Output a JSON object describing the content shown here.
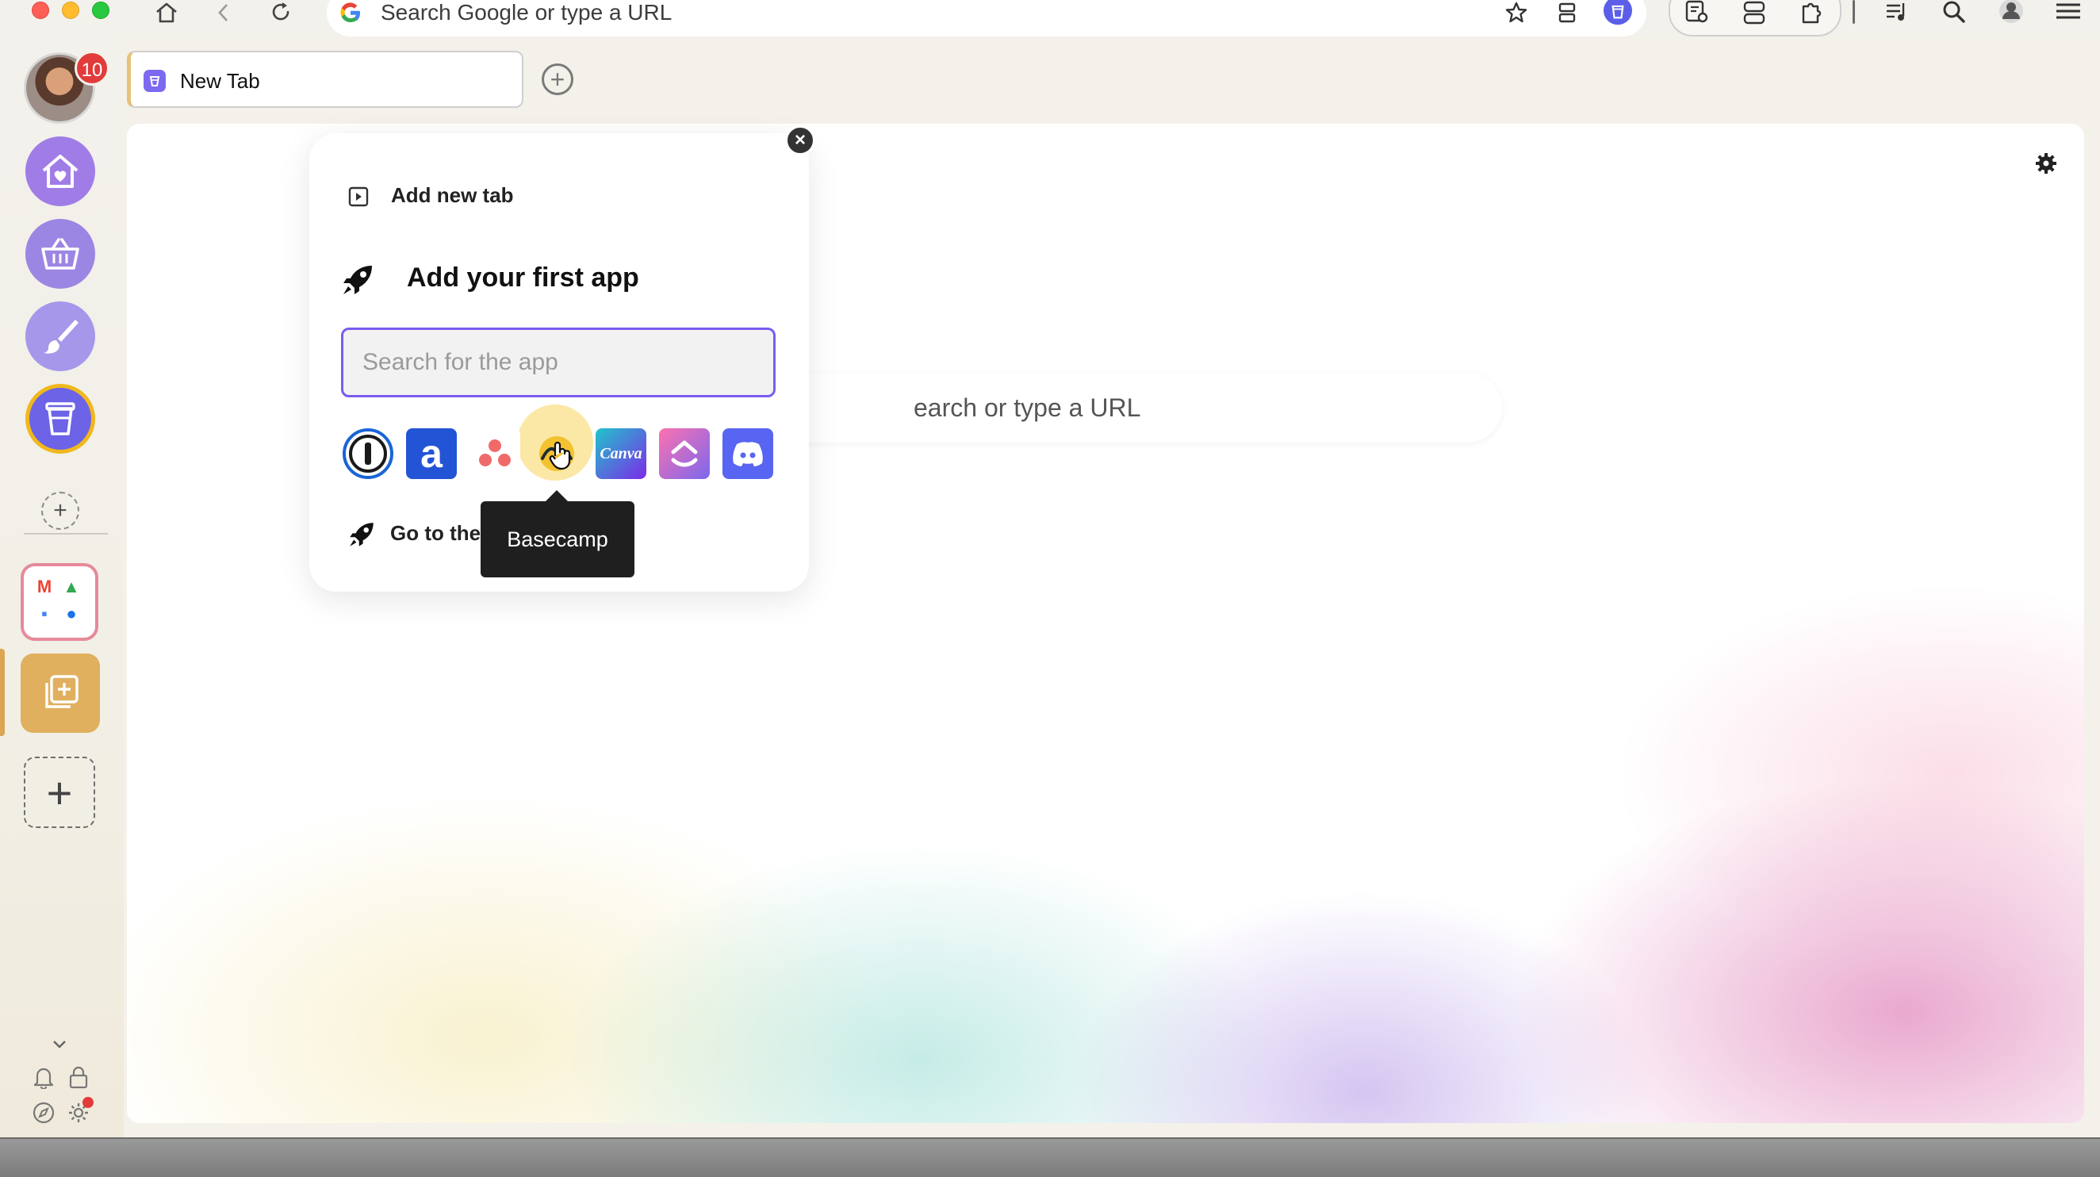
{
  "toolbar": {
    "omnibox_text": "Search Google or type a URL"
  },
  "sidebar": {
    "notification_count": "10",
    "apps": [
      {
        "name": "home",
        "icon": "house-heart-icon"
      },
      {
        "name": "shopping",
        "icon": "basket-icon"
      },
      {
        "name": "design",
        "icon": "brush-icon"
      },
      {
        "name": "cup",
        "icon": "cup-icon"
      }
    ],
    "google_apps": [
      "M",
      "▲",
      "▪",
      "●"
    ]
  },
  "tab": {
    "title": "New Tab"
  },
  "content": {
    "search_text": "earch or type a URL"
  },
  "popup": {
    "add_new_tab": "Add new tab",
    "add_first_app": "Add your first app",
    "search_placeholder": "Search for the app",
    "go_to": "Go to the",
    "tooltip": "Basecamp",
    "apps": [
      {
        "name": "1Password",
        "color": "#1a65d6"
      },
      {
        "name": "Amazon",
        "color": "#2454d6"
      },
      {
        "name": "Asana",
        "color": "#f06a6a"
      },
      {
        "name": "Basecamp",
        "color": "#f2c230"
      },
      {
        "name": "Canva",
        "color": "#3f8fd8"
      },
      {
        "name": "ClickUp",
        "color": "#9b3be0"
      },
      {
        "name": "Discord",
        "color": "#5865f2"
      }
    ],
    "app_glyphs": {
      "amazon": "a",
      "canva": "Canva"
    }
  }
}
